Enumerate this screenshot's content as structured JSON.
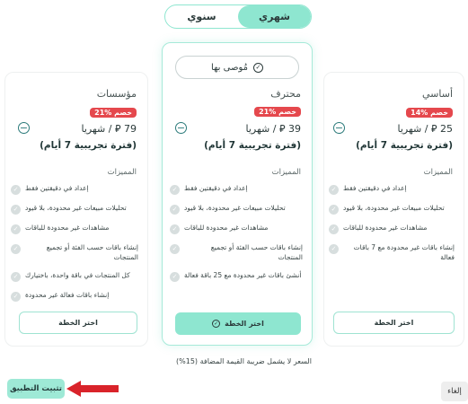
{
  "billing_toggle": {
    "monthly": "شهري",
    "yearly": "سنوي"
  },
  "plans": [
    {
      "name": "أساسي",
      "discount": "14% خصم",
      "price": "25",
      "period": "/ شهريا",
      "trial": "(فترة تجريبية 7 أيام)",
      "features_title": "المميزات",
      "features": [
        "إعداد في دقيقتين فقط",
        "تحليلات مبيعات غير محدودة، بلا قيود",
        "مشاهدات غير محدودة للباقات",
        "إنشاء باقات غير محدودة مع 7 باقات فعالة"
      ],
      "cta": "اختر الخطة"
    },
    {
      "name": "محترف",
      "recommended": "مُوصى بها",
      "discount": "21% خصم",
      "price": "39",
      "period": "/ شهريا",
      "trial": "(فترة تجريبية 7 أيام)",
      "features_title": "المميزات",
      "features": [
        "إعداد في دقيقتين فقط",
        "تحليلات مبيعات غير محدودة، بلا قيود",
        "مشاهدات غير محدودة للباقات",
        "إنشاء باقات حسب الفئة أو تجميع المنتجات",
        "أنشئ باقات غير محدودة مع 25 باقة فعالة"
      ],
      "cta": "اختر الخطة"
    },
    {
      "name": "مؤسسات",
      "discount": "21% خصم",
      "price": "79",
      "period": "/ شهريا",
      "trial": "(فترة تجريبية 7 أيام)",
      "features_title": "المميزات",
      "features": [
        "إعداد في دقيقتين فقط",
        "تحليلات مبيعات غير محدودة، بلا قيود",
        "مشاهدات غير محدودة للباقات",
        "إنشاء باقات حسب الفئة أو تجميع المنتجات",
        "كل المنتجات في باقة واحدة، باختيارك",
        "إنشاء باقات فعالة غير محدودة"
      ],
      "cta": "اختر الخطة"
    }
  ],
  "tax_note": "السعر لا يشمل ضريبة القيمة المضافة (15%)",
  "install_button": "تثبيت التطبيق",
  "cancel_button": "إلغاء",
  "colors": {
    "accent": "#8ee6d0",
    "discount": "#e5484d",
    "arrow": "#d9232a"
  }
}
